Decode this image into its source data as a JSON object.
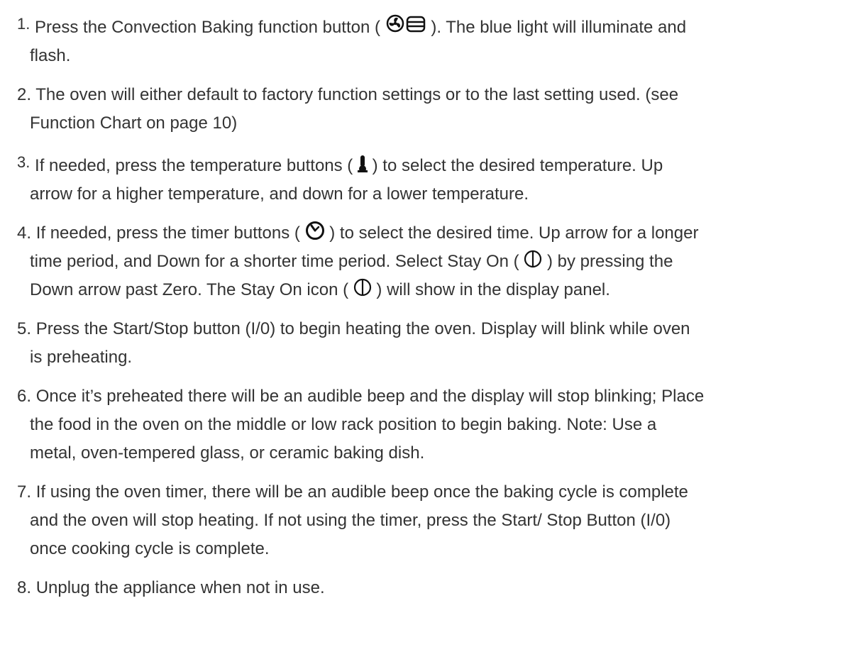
{
  "steps": [
    {
      "number": "1.",
      "lines": [
        {
          "before": "Press the Convection Baking function button ( ",
          "after": "). The blue light will illuminate and"
        },
        {
          "text": "flash."
        }
      ],
      "icon": "convection-fan-icon"
    },
    {
      "number": "2.",
      "lines": [
        {
          "text": "The oven will either default to factory function settings or to the last setting used. (see"
        },
        {
          "text": "Function Chart on page 10)"
        }
      ]
    },
    {
      "number": "3.",
      "lines": [
        {
          "before": "If needed, press the temperature buttons ( ",
          "after": ") to select the desired temperature. Up"
        },
        {
          "text": "arrow for a higher temperature, and down for a lower temperature."
        }
      ],
      "icon": "thermometer-icon"
    },
    {
      "number": "4.",
      "lines": [
        {
          "before": "If needed, press the timer buttons ( ",
          "after": ") to select the desired time. Up arrow for a longer"
        },
        {
          "before": "time period, and Down for a shorter time period. Select Stay On ( ",
          "after": ") by pressing the"
        },
        {
          "before": "Down arrow past Zero. The Stay On icon ( ",
          "after": ") will show in the display panel."
        }
      ],
      "icons": [
        "timer-icon",
        "stay-on-icon",
        "stay-on-icon"
      ]
    },
    {
      "number": "5.",
      "lines": [
        {
          "text": "Press the Start/Stop button (I/0) to begin heating the oven. Display will blink while oven"
        },
        {
          "text": "is preheating."
        }
      ]
    },
    {
      "number": "6.",
      "lines": [
        {
          "text": "Once it’s preheated there will be an audible beep and the display will stop blinking; Place"
        },
        {
          "text": "the food in the oven on the middle or low rack position to begin baking. Note: Use a"
        },
        {
          "text": "metal, oven-tempered glass, or ceramic baking dish."
        }
      ]
    },
    {
      "number": "7.",
      "lines": [
        {
          "text": "If using the oven timer, there will be an audible beep once the baking cycle is complete"
        },
        {
          "text": "and the oven will stop heating. If not using the timer, press the Start/ Stop Button (I/0)"
        },
        {
          "text": "once cooking cycle is complete."
        }
      ]
    },
    {
      "number": "8.",
      "lines": [
        {
          "text": "Unplug the appliance when not in use."
        }
      ]
    }
  ],
  "colors": {
    "text": "#333333",
    "background": "#ffffff"
  }
}
